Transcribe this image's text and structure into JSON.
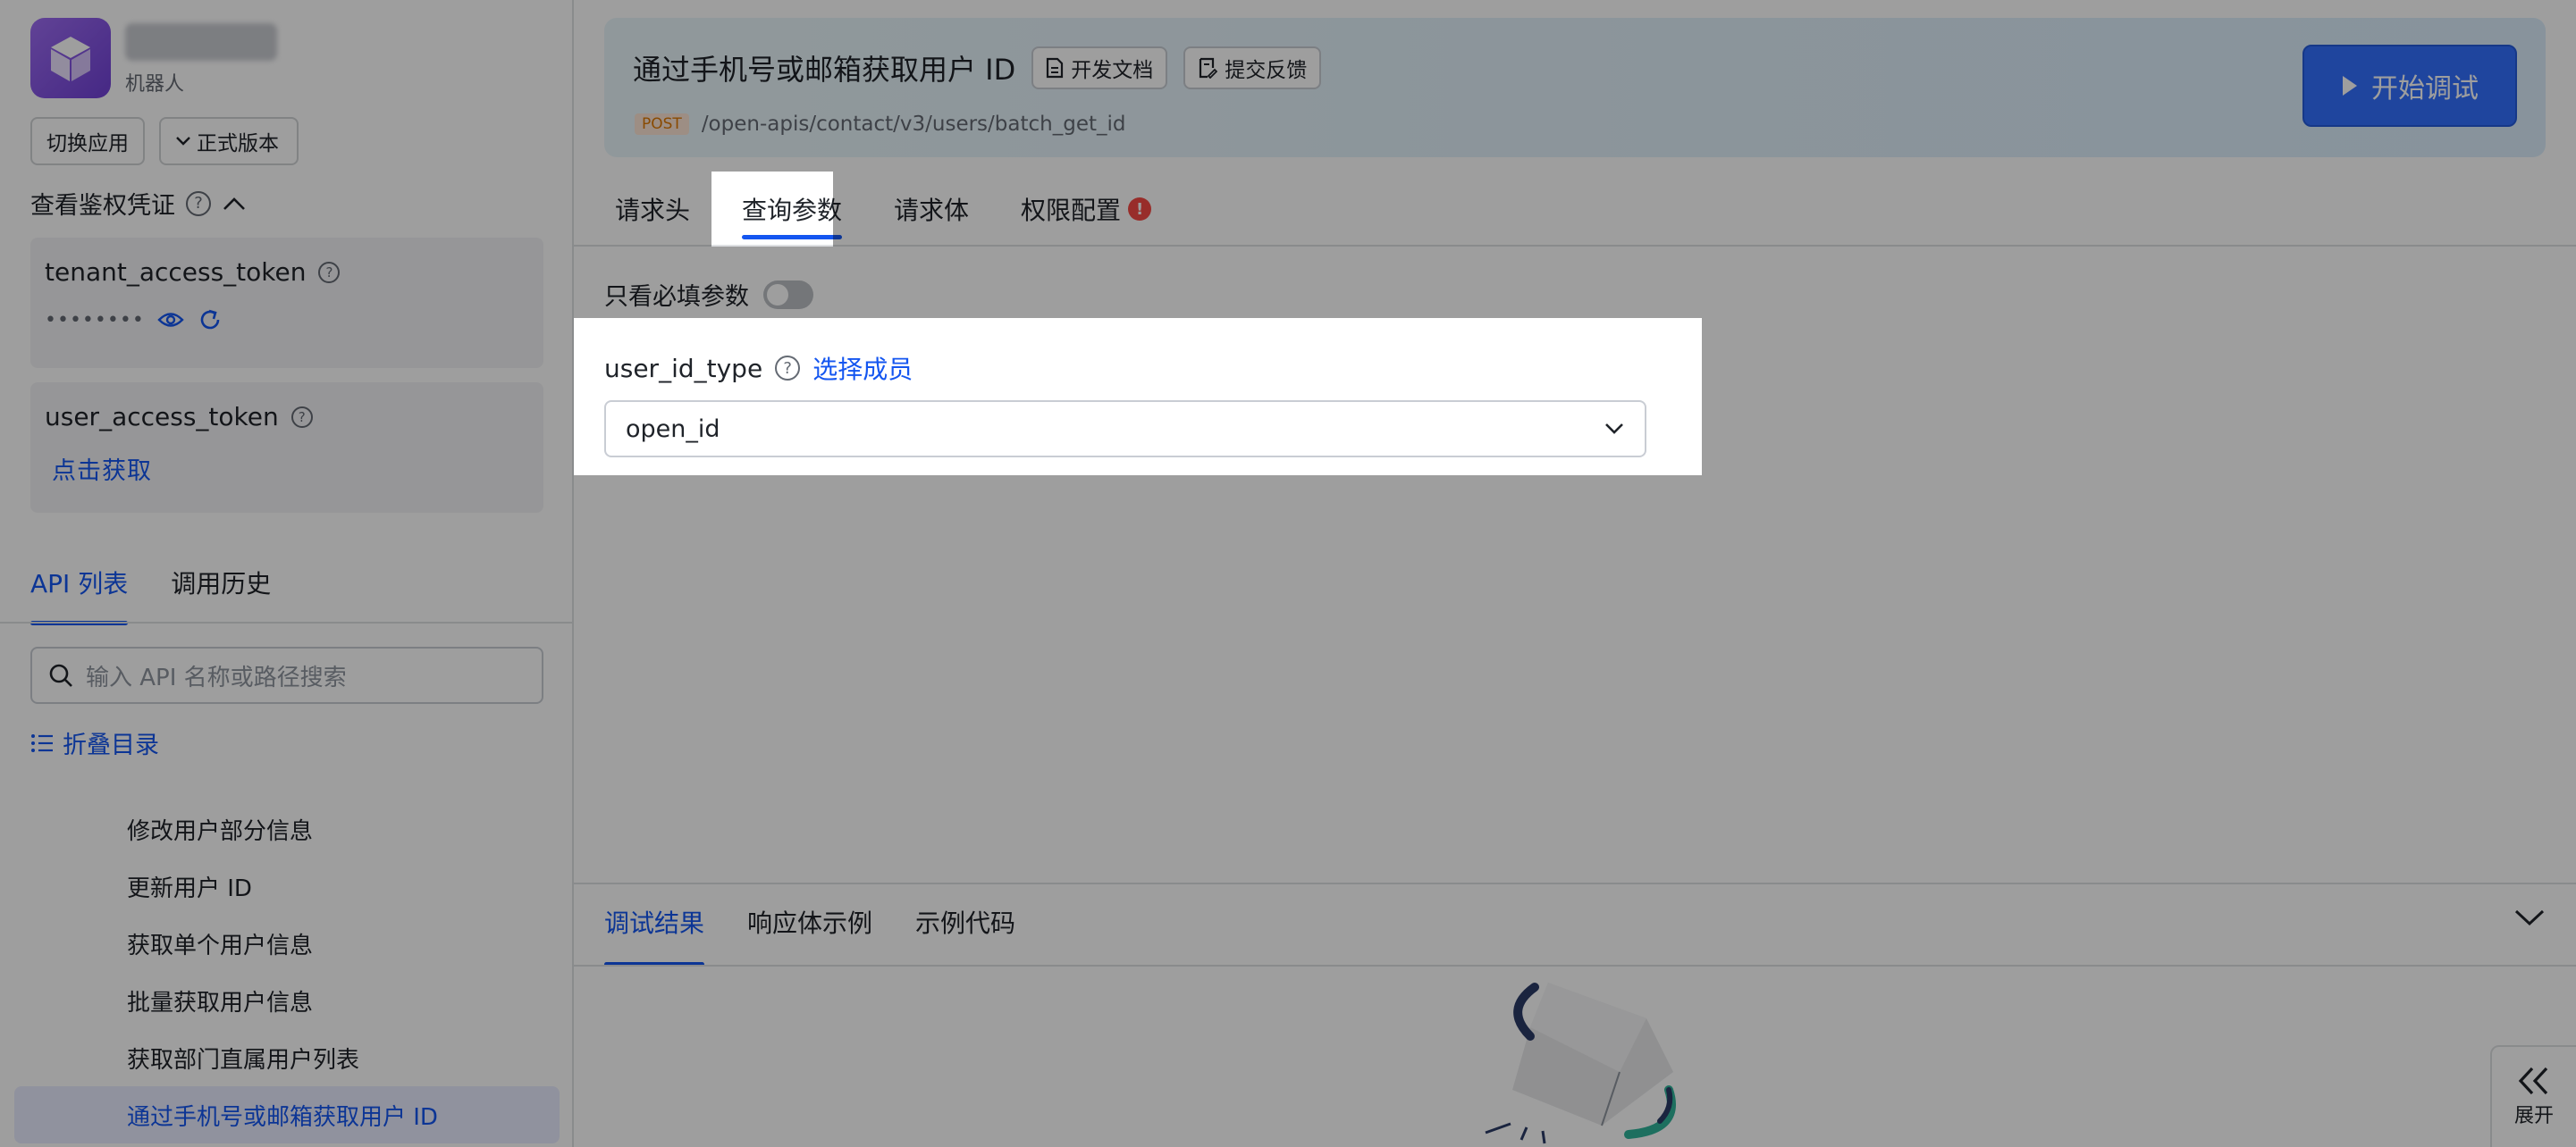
{
  "sidebar": {
    "app_role": "机器人",
    "switch_app": "切换应用",
    "version": "正式版本",
    "auth_section_title": "查看鉴权凭证",
    "tenant_token": {
      "label": "tenant_access_token",
      "masked_value": "••••••••"
    },
    "user_token": {
      "label": "user_access_token",
      "action": "点击获取"
    },
    "tabs": [
      {
        "label": "API 列表",
        "active": true
      },
      {
        "label": "调用历史",
        "active": false
      }
    ],
    "search_placeholder": "输入 API 名称或路径搜索",
    "collapse_label": "折叠目录",
    "api_items": [
      {
        "label": "修改用户部分信息",
        "active": false
      },
      {
        "label": "更新用户 ID",
        "active": false
      },
      {
        "label": "获取单个用户信息",
        "active": false
      },
      {
        "label": "批量获取用户信息",
        "active": false
      },
      {
        "label": "获取部门直属用户列表",
        "active": false
      },
      {
        "label": "通过手机号或邮箱获取用户 ID",
        "active": true
      }
    ]
  },
  "header": {
    "title": "通过手机号或邮箱获取用户 ID",
    "doc_button": "开发文档",
    "feedback_button": "提交反馈",
    "method": "POST",
    "path": "/open-apis/contact/v3/users/batch_get_id",
    "start_button": "开始调试"
  },
  "request_tabs": [
    {
      "label": "请求头",
      "active": false
    },
    {
      "label": "查询参数",
      "active": true
    },
    {
      "label": "请求体",
      "active": false
    },
    {
      "label": "权限配置",
      "active": false,
      "error": true
    }
  ],
  "params": {
    "required_only_label": "只看必填参数",
    "required_only_on": false,
    "field_name": "user_id_type",
    "field_link": "选择成员",
    "field_value": "open_id"
  },
  "result_tabs": [
    {
      "label": "调试结果",
      "active": true
    },
    {
      "label": "响应体示例",
      "active": false
    },
    {
      "label": "示例代码",
      "active": false
    }
  ],
  "expand_label": "展开",
  "colors": {
    "accent": "#1456f0",
    "primary_button": "#3370ff",
    "error": "#f54a45",
    "method_badge": "#de7802"
  }
}
